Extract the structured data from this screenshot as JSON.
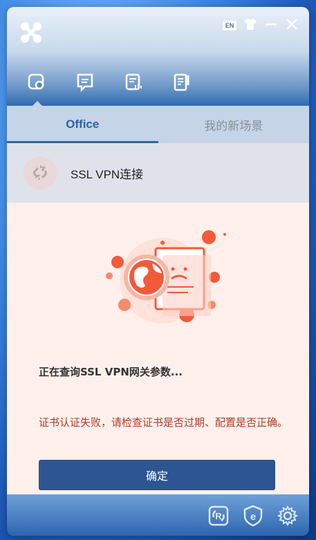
{
  "window": {
    "lang_badge": "EN"
  },
  "tabs": [
    {
      "label": "Office"
    },
    {
      "label": "我的新场景"
    }
  ],
  "connection": {
    "label": "SSL VPN连接"
  },
  "status": {
    "message": "正在查询SSL VPN网关参数...",
    "error": "证书认证失败，请检查证书是否过期、配置是否正确。"
  },
  "buttons": {
    "confirm": "确定"
  },
  "colors": {
    "accent": "#2c5592",
    "error": "#b23a26",
    "active_tab": "#2b64a8"
  },
  "icons": {
    "logo": "app-logo-icon",
    "nav": [
      "link-icon",
      "message-icon",
      "log-icon",
      "notes-icon"
    ],
    "bottom": [
      "sync-icon",
      "shield-e-icon",
      "gear-icon"
    ]
  }
}
